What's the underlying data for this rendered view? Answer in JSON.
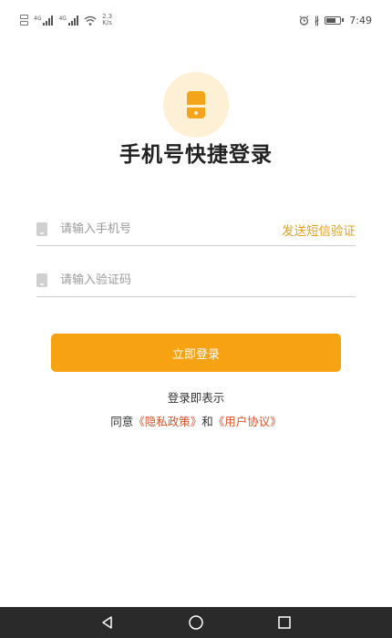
{
  "status_bar": {
    "speed_value": "2.3",
    "speed_unit": "K/s",
    "signal_tag_1": "4G",
    "signal_tag_2": "4G",
    "bluetooth_glyph": "∦",
    "time": "7:49"
  },
  "login": {
    "title": "手机号快捷登录",
    "phone_placeholder": "请输入手机号",
    "send_code_label": "发送短信验证",
    "code_placeholder": "请输入验证码",
    "login_button": "立即登录"
  },
  "agreement": {
    "line1": "登录即表示",
    "prefix": "同意",
    "privacy_link": "《隐私政策》",
    "conjunction": "和",
    "user_agreement_link": "《用户协议》"
  },
  "colors": {
    "accent": "#f7a213",
    "accent_text": "#e0a223",
    "link": "#d9552c",
    "logo_bg": "#fdf0d4",
    "nav_bar": "#2a2a2a"
  },
  "icons": {
    "logo": "phone-icon",
    "phone_field": "phone-icon",
    "code_field": "lock-icon",
    "nav_back": "back-triangle-icon",
    "nav_home": "home-circle-icon",
    "nav_recent": "recent-square-icon"
  }
}
